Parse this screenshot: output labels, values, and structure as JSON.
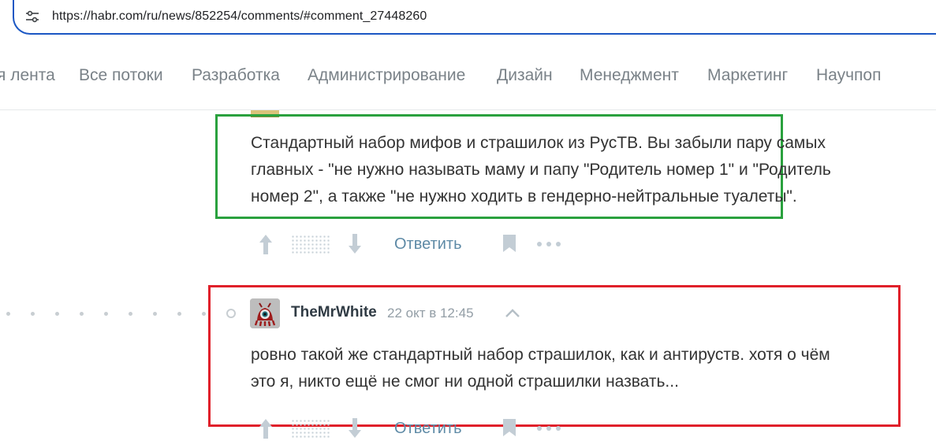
{
  "browser": {
    "url": "https://habr.com/ru/news/852254/comments/#comment_27448260"
  },
  "nav": {
    "items": [
      "я лента",
      "Все потоки",
      "Разработка",
      "Администрирование",
      "Дизайн",
      "Менеджмент",
      "Маркетинг",
      "Научпоп"
    ]
  },
  "comment1": {
    "lines": [
      "Стандартный набор мифов и страшилок из РусТВ. Вы забыли пару самых",
      "главных - \"не нужно называть маму и папу \"Родитель номер 1\" и \"Родитель",
      "номер 2\", а также \"не нужно ходить в гендерно-нейтральные туалеты\"."
    ],
    "reply_label": "Ответить"
  },
  "comment2": {
    "username": "TheMrWhite",
    "timestamp": "22 окт в 12:45",
    "lines": [
      "ровно такой же стандартный набор страшилок, как и антируств. хотя о чём",
      "это я, никто ещё не смог ни одной страшилки назвать..."
    ],
    "reply_label": "Ответить"
  },
  "colors": {
    "highlight_green": "#2aa13e",
    "highlight_red": "#e0202a",
    "url_bar_border": "#1b57c4",
    "link_blue": "#5e8aa6"
  }
}
